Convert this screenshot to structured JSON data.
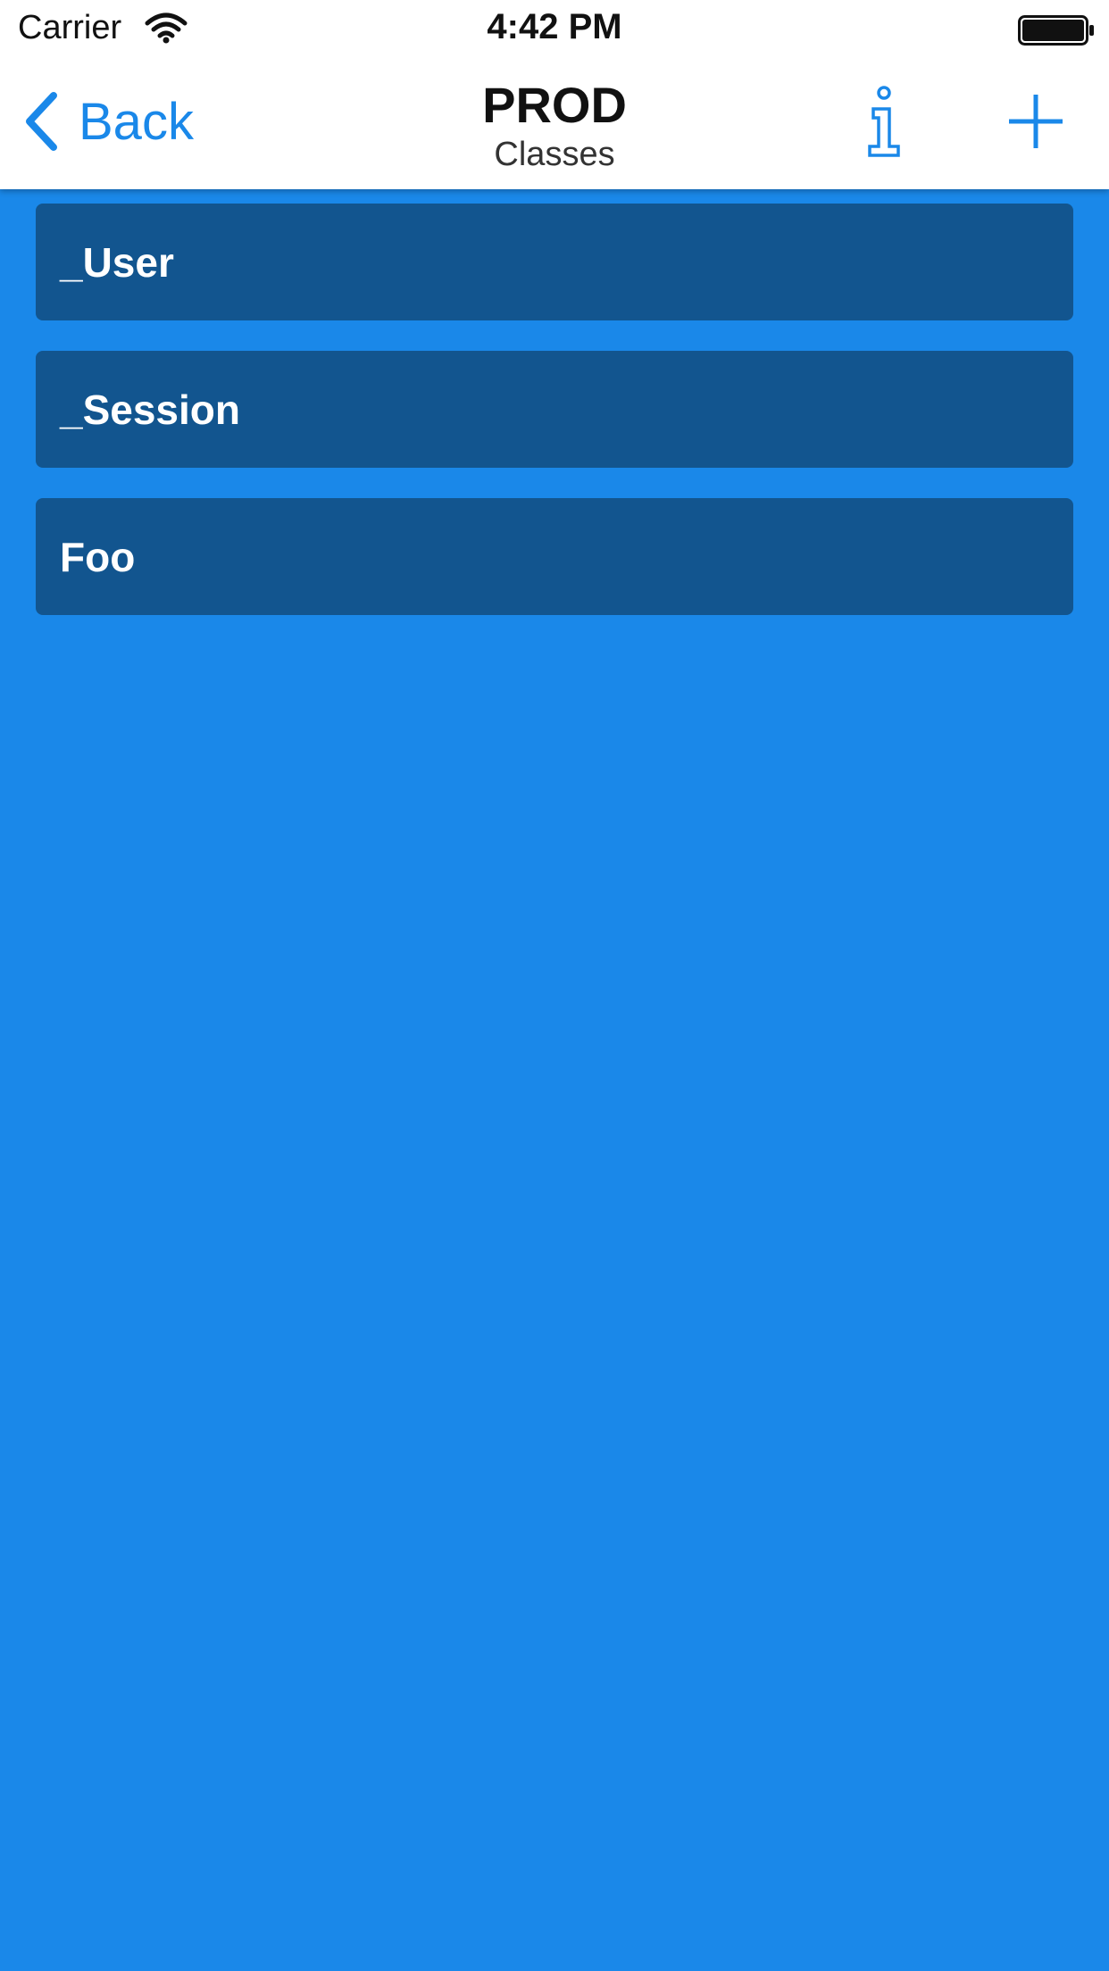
{
  "status_bar": {
    "carrier": "Carrier",
    "time": "4:42 PM",
    "wifi_icon": "wifi-icon",
    "battery_icon": "battery-icon"
  },
  "nav": {
    "back_label": "Back",
    "back_icon": "chevron-left-icon",
    "title": "PROD",
    "subtitle": "Classes",
    "info_icon": "info-icon",
    "add_icon": "plus-icon"
  },
  "classes": [
    {
      "label": "_User"
    },
    {
      "label": "_Session"
    },
    {
      "label": "Foo"
    }
  ],
  "colors": {
    "background": "#1a88e9",
    "accent": "#1a88e9",
    "row": "#12558f",
    "nav_background": "#ffffff"
  }
}
